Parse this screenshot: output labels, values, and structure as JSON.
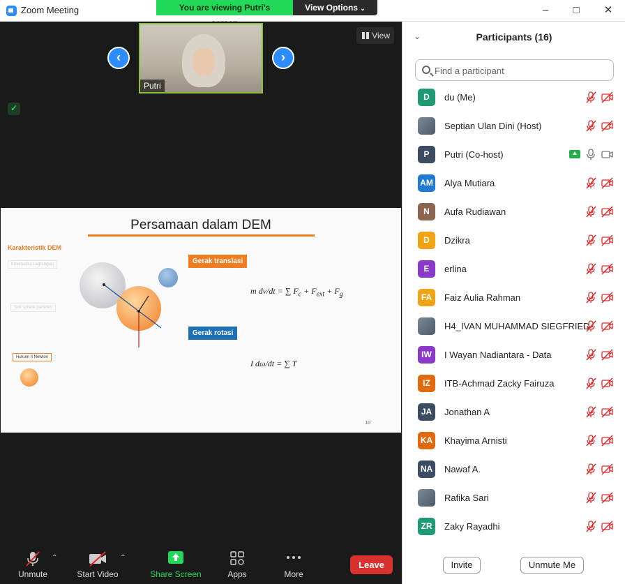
{
  "window": {
    "title": "Zoom Meeting"
  },
  "share_banner": {
    "viewing": "You are viewing Putri's screen",
    "view_options": "View Options"
  },
  "video": {
    "speaker_name": "Putri",
    "view_label": "View"
  },
  "slide": {
    "title": "Persamaan dalam DEM",
    "side_heading": "Karakteristik DEM",
    "side_items": [
      "Kinematika Lagrangian",
      "Soft sphere particles",
      "Hukum II Newton"
    ],
    "translation_label": "Gerak translasi",
    "rotation_label": "Gerak rotasi",
    "page_number": "10"
  },
  "participants": {
    "header": "Participants (16)",
    "search_placeholder": "Find a participant",
    "list": [
      {
        "initials": "D",
        "name": "du (Me)",
        "color": "#1f9a74",
        "photo": false,
        "muted": true,
        "video_off": true,
        "sharing": false
      },
      {
        "initials": "",
        "name": "Septian Ulan Dini (Host)",
        "color": "#6e7a86",
        "photo": true,
        "muted": true,
        "video_off": true,
        "sharing": false
      },
      {
        "initials": "P",
        "name": "Putri (Co-host)",
        "color": "#3c4d63",
        "photo": false,
        "muted": false,
        "video_off": false,
        "sharing": true
      },
      {
        "initials": "AM",
        "name": "Alya Mutiara",
        "color": "#1f7ad1",
        "photo": false,
        "muted": true,
        "video_off": true,
        "sharing": false
      },
      {
        "initials": "N",
        "name": "Aufa Rudiawan",
        "color": "#8c6552",
        "photo": false,
        "muted": true,
        "video_off": true,
        "sharing": false
      },
      {
        "initials": "D",
        "name": "Dzikra",
        "color": "#f0a314",
        "photo": false,
        "muted": true,
        "video_off": true,
        "sharing": false
      },
      {
        "initials": "E",
        "name": "erlina",
        "color": "#8a39c9",
        "photo": false,
        "muted": true,
        "video_off": true,
        "sharing": false
      },
      {
        "initials": "FA",
        "name": "Faiz Aulia Rahman",
        "color": "#f0a314",
        "photo": false,
        "muted": true,
        "video_off": true,
        "sharing": false
      },
      {
        "initials": "",
        "name": "H4_IVAN MUHAMMAD SIEGFRIED",
        "color": "#6e7a86",
        "photo": true,
        "muted": true,
        "video_off": true,
        "sharing": false
      },
      {
        "initials": "IW",
        "name": "I Wayan Nadiantara - Data",
        "color": "#8a39c9",
        "photo": false,
        "muted": true,
        "video_off": true,
        "sharing": false
      },
      {
        "initials": "IZ",
        "name": "ITB-Achmad Zacky Fairuza",
        "color": "#e06a10",
        "photo": false,
        "muted": true,
        "video_off": true,
        "sharing": false
      },
      {
        "initials": "JA",
        "name": "Jonathan A",
        "color": "#3c4d63",
        "photo": false,
        "muted": true,
        "video_off": true,
        "sharing": false
      },
      {
        "initials": "KA",
        "name": "Khayima Arnisti",
        "color": "#e06a10",
        "photo": false,
        "muted": true,
        "video_off": true,
        "sharing": false
      },
      {
        "initials": "NA",
        "name": "Nawaf A.",
        "color": "#3c4d63",
        "photo": false,
        "muted": true,
        "video_off": true,
        "sharing": false
      },
      {
        "initials": "",
        "name": "Rafika Sari",
        "color": "#6e7a86",
        "photo": true,
        "muted": true,
        "video_off": true,
        "sharing": false
      },
      {
        "initials": "ZR",
        "name": "Zaky Rayadhi",
        "color": "#1f9a74",
        "photo": false,
        "muted": true,
        "video_off": true,
        "sharing": false
      }
    ],
    "invite_label": "Invite",
    "unmute_me_label": "Unmute Me"
  },
  "toolbar": {
    "unmute": "Unmute",
    "start_video": "Start Video",
    "share_screen": "Share Screen",
    "apps": "Apps",
    "more": "More",
    "leave": "Leave"
  },
  "colors": {
    "accent": "#2d8cff",
    "share_green": "#23d959",
    "leave_red": "#d9322e",
    "muted_red": "#e02828",
    "slide_orange": "#ef7d22"
  }
}
